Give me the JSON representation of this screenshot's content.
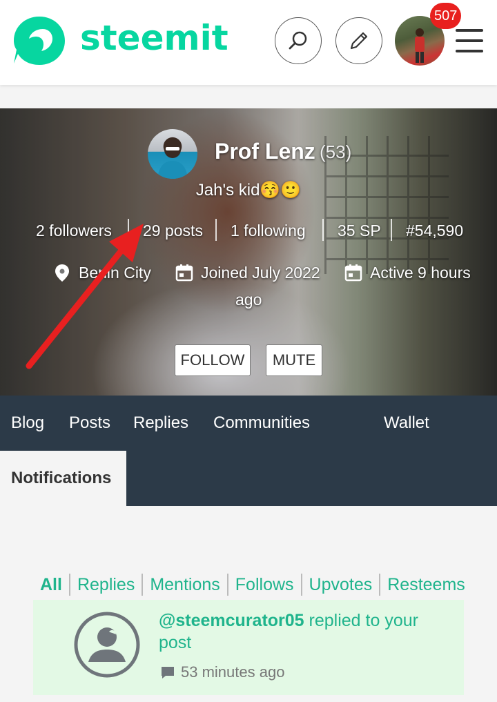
{
  "header": {
    "logo_text": "steemit",
    "notification_count": "507"
  },
  "profile": {
    "name": "Prof Lenz",
    "reputation": "(53)",
    "about": "Jah's kid😚🙂",
    "stats": {
      "followers": "2 followers",
      "posts": "29 posts",
      "following": "1 following",
      "sp": "35 SP",
      "rank": "#54,590"
    },
    "location": "Benin City",
    "joined": "Joined July 2022",
    "active": "Active 9 hours",
    "active_wrap": "ago",
    "follow_label": "FOLLOW",
    "mute_label": "MUTE"
  },
  "tabs": {
    "blog": "Blog",
    "posts": "Posts",
    "replies": "Replies",
    "communities": "Communities",
    "wallet": "Wallet",
    "notifications": "Notifications"
  },
  "filters": [
    "All",
    "Replies",
    "Mentions",
    "Follows",
    "Upvotes",
    "Resteems"
  ],
  "notification": {
    "user": "@steemcurator05",
    "action": " replied to your post",
    "time": "53 minutes ago"
  },
  "colors": {
    "brand": "#07d6a0",
    "link": "#1fb48c",
    "tabbar": "#2c3a48",
    "badge": "#e8201e",
    "card": "#e3f9e5",
    "arrow": "#e82020"
  }
}
